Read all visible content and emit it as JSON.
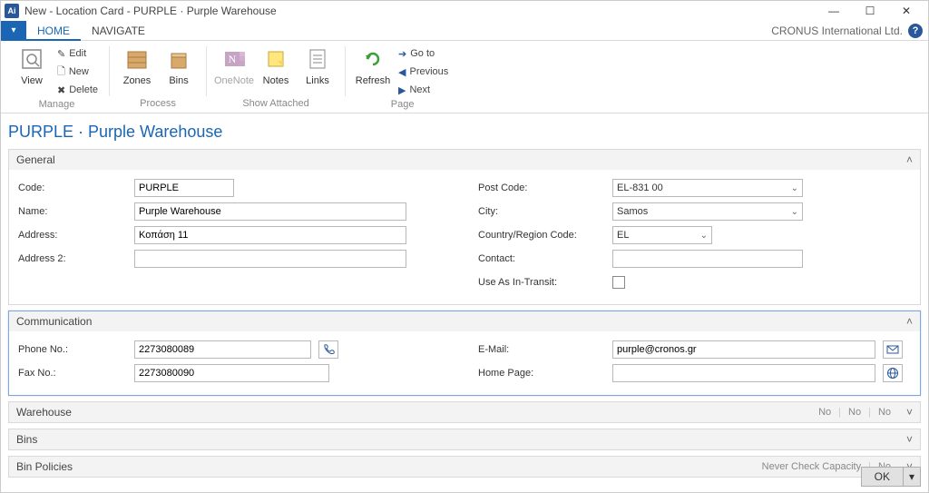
{
  "window": {
    "title": "New - Location Card - PURPLE · Purple Warehouse"
  },
  "ribbon": {
    "tabs": {
      "home": "HOME",
      "navigate": "NAVIGATE"
    },
    "company": "CRONUS International Ltd.",
    "manage": {
      "view": "View",
      "edit": "Edit",
      "new": "New",
      "delete": "Delete",
      "label": "Manage"
    },
    "process": {
      "zones": "Zones",
      "bins": "Bins",
      "label": "Process"
    },
    "showattached": {
      "onenote": "OneNote",
      "notes": "Notes",
      "links": "Links",
      "label": "Show Attached"
    },
    "page": {
      "refresh": "Refresh",
      "goto": "Go to",
      "previous": "Previous",
      "next": "Next",
      "label": "Page"
    }
  },
  "pageTitle": "PURPLE · Purple Warehouse",
  "general": {
    "title": "General",
    "code_label": "Code:",
    "code": "PURPLE",
    "name_label": "Name:",
    "name": "Purple Warehouse",
    "address_label": "Address:",
    "address": "Κοπάση 11",
    "address2_label": "Address 2:",
    "address2": "",
    "postcode_label": "Post Code:",
    "postcode": "EL-831 00",
    "city_label": "City:",
    "city": "Samos",
    "country_label": "Country/Region Code:",
    "country": "EL",
    "contact_label": "Contact:",
    "contact": "",
    "useastransit_label": "Use As In-Transit:",
    "useastransit": false
  },
  "communication": {
    "title": "Communication",
    "phone_label": "Phone No.:",
    "phone": "2273080089",
    "fax_label": "Fax No.:",
    "fax": "2273080090",
    "email_label": "E-Mail:",
    "email": "purple@cronos.gr",
    "homepage_label": "Home Page:",
    "homepage": ""
  },
  "warehouse": {
    "title": "Warehouse",
    "summary1": "No",
    "summary2": "No",
    "summary3": "No"
  },
  "bins": {
    "title": "Bins"
  },
  "binpolicies": {
    "title": "Bin Policies",
    "summary1": "Never Check Capacity",
    "summary2": "No"
  },
  "ok": "OK"
}
